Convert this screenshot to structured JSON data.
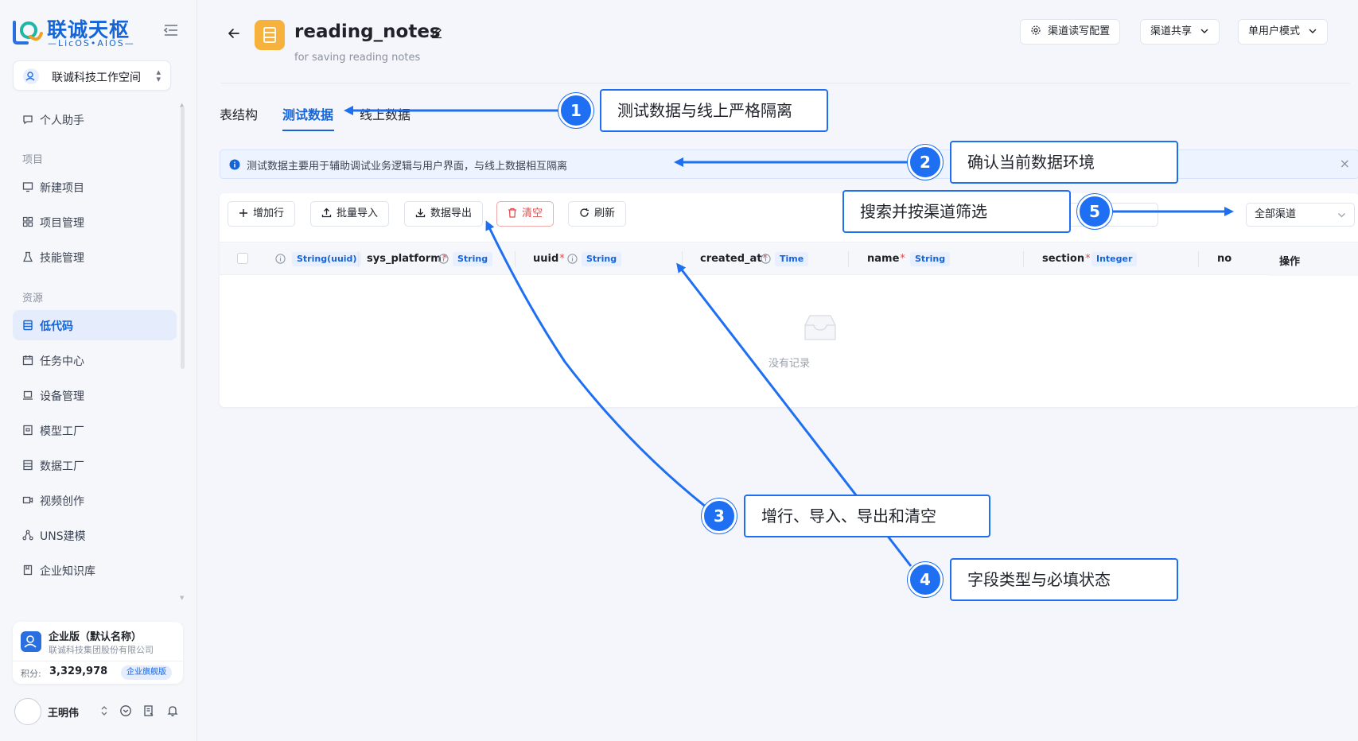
{
  "brand": {
    "title": "联诚天枢",
    "subtitle": "—LicOS•AIOS—"
  },
  "workspace": {
    "label": "联诚科技工作空间"
  },
  "nav": {
    "assistant": "个人助手",
    "section_project": "项目",
    "new_project": "新建项目",
    "project_manage": "项目管理",
    "skill_manage": "技能管理",
    "section_resource": "资源",
    "lowcode": "低代码",
    "task_center": "任务中心",
    "device_manage": "设备管理",
    "model_factory": "模型工厂",
    "data_factory": "数据工厂",
    "video_create": "视频创作",
    "uns_modeling": "UNS建模",
    "knowledge_base": "企业知识库"
  },
  "org": {
    "name": "企业版（默认名称）",
    "company": "联诚科技集团股份有限公司",
    "points_label": "积分:",
    "points_value": "3,329,978",
    "plan_badge": "企业旗舰版"
  },
  "user": {
    "name": "王明伟"
  },
  "page": {
    "title": "reading_notes",
    "subtitle": "for saving reading notes"
  },
  "header": {
    "channel_config": "渠道读写配置",
    "channel_share": "渠道共享",
    "user_mode": "单用户模式"
  },
  "tabs": [
    {
      "label": "表结构"
    },
    {
      "label": "测试数据"
    },
    {
      "label": "线上数据"
    }
  ],
  "info": {
    "text": "测试数据主要用于辅助调试业务逻辑与用户界面，与线上数据相互隔离",
    "close": "×"
  },
  "toolbar": {
    "add_row": "增加行",
    "batch_import": "批量导入",
    "export_data": "数据导出",
    "clear": "清空",
    "refresh": "刷新"
  },
  "channel_select": {
    "value": "全部渠道"
  },
  "table": {
    "columns": [
      {
        "name": "",
        "required": "",
        "type": "String(uuid)"
      },
      {
        "name": "sys_platform",
        "required": "*",
        "type": "String"
      },
      {
        "name": "uuid",
        "required": "*",
        "type": "String"
      },
      {
        "name": "created_at",
        "required": "*",
        "type": "Time"
      },
      {
        "name": "name",
        "required": "*",
        "type": "String"
      },
      {
        "name": "section",
        "required": "*",
        "type": "Integer"
      },
      {
        "name": "no",
        "required": "",
        "type": ""
      }
    ],
    "actions_header": "操作",
    "empty_text": "没有记录"
  },
  "annotations": [
    {
      "num": "1",
      "text": "测试数据与线上严格隔离"
    },
    {
      "num": "2",
      "text": "确认当前数据环境"
    },
    {
      "num": "3",
      "text": "增行、导入、导出和清空"
    },
    {
      "num": "4",
      "text": "字段类型与必填状态"
    },
    {
      "num": "5",
      "text": "搜索并按渠道筛选"
    }
  ],
  "colors": {
    "primary": "#1565d8",
    "annotation": "#1f6ff2",
    "danger": "#e24c4c",
    "file_icon": "#f7b13d"
  }
}
